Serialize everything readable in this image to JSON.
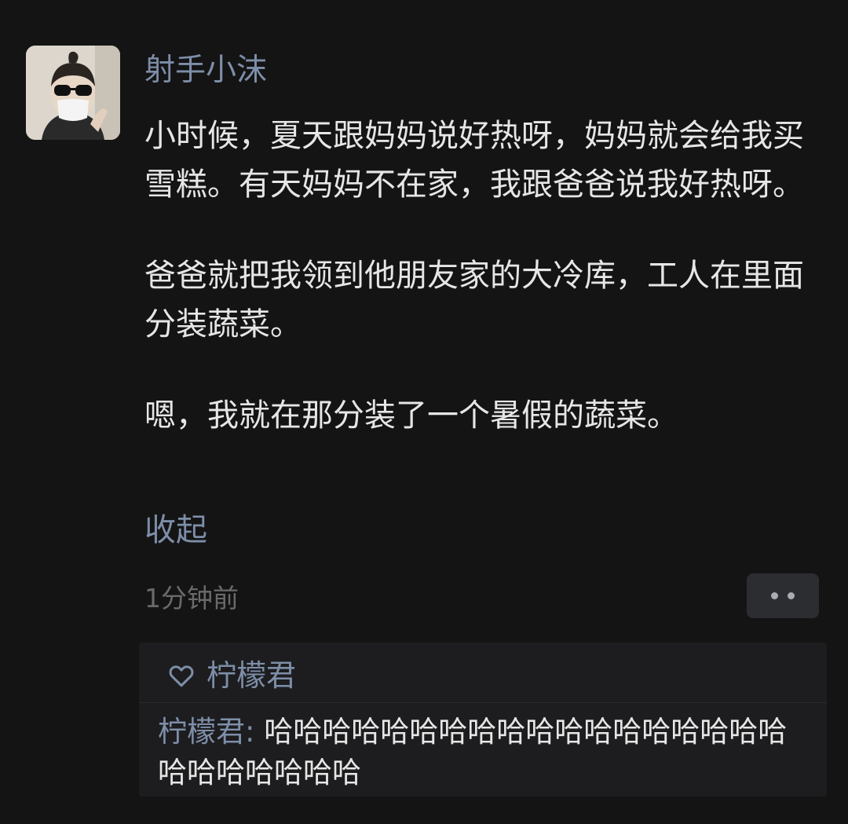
{
  "post": {
    "username": "射手小沫",
    "paragraphs": [
      "小时候，夏天跟妈妈说好热呀，妈妈就会给我买雪糕。有天妈妈不在家，我跟爸爸说我好热呀。",
      "爸爸就把我领到他朋友家的大冷库，工人在里面分装蔬菜。",
      "嗯，我就在那分装了一个暑假的蔬菜。"
    ],
    "collapse_label": "收起",
    "timestamp": "1分钟前",
    "more_icon": "more-dots-icon"
  },
  "interaction": {
    "like_icon": "heart-icon",
    "liked_by": "柠檬君",
    "comments": [
      {
        "author": "柠檬君",
        "separator": ": ",
        "text": "哈哈哈哈哈哈哈哈哈哈哈哈哈哈哈哈哈哈哈哈哈哈哈哈哈"
      }
    ]
  }
}
